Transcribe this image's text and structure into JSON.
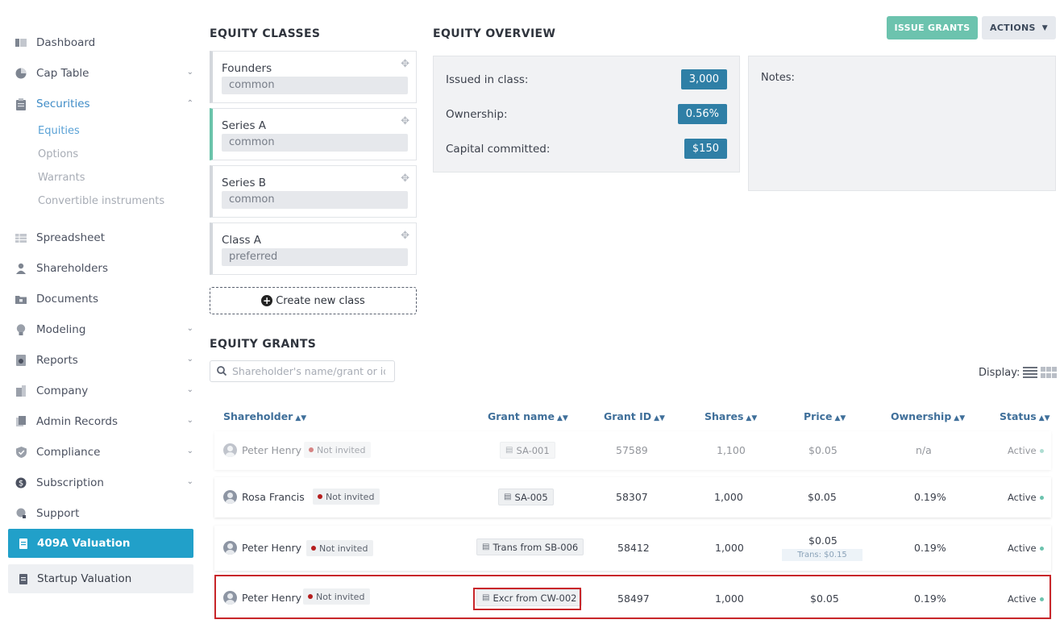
{
  "sidebar": {
    "items": [
      {
        "label": "Dashboard",
        "icon": "dashboard-icon",
        "chevron": ""
      },
      {
        "label": "Cap Table",
        "icon": "pie-chart-icon",
        "chevron": "down"
      },
      {
        "label": "Securities",
        "icon": "clipboard-icon",
        "chevron": "up",
        "active": true
      },
      {
        "label": "Spreadsheet",
        "icon": "spreadsheet-icon",
        "chevron": ""
      },
      {
        "label": "Shareholders",
        "icon": "person-icon",
        "chevron": ""
      },
      {
        "label": "Documents",
        "icon": "folder-lock-icon",
        "chevron": ""
      },
      {
        "label": "Modeling",
        "icon": "lightbulb-icon",
        "chevron": "down"
      },
      {
        "label": "Reports",
        "icon": "report-icon",
        "chevron": "down"
      },
      {
        "label": "Company",
        "icon": "building-icon",
        "chevron": "down"
      },
      {
        "label": "Admin Records",
        "icon": "admin-records-icon",
        "chevron": "down"
      },
      {
        "label": "Compliance",
        "icon": "shield-check-icon",
        "chevron": "down"
      },
      {
        "label": "Subscription",
        "icon": "dollar-circle-icon",
        "chevron": "down"
      },
      {
        "label": "Support",
        "icon": "support-icon",
        "chevron": ""
      }
    ],
    "securities_sub": [
      {
        "label": "Equities",
        "active": true
      },
      {
        "label": "Options"
      },
      {
        "label": "Warrants"
      },
      {
        "label": "Convertible instruments"
      }
    ],
    "valuation_409a": "409A Valuation",
    "startup_valuation": "Startup Valuation"
  },
  "equity_classes": {
    "title": "EQUITY CLASSES",
    "classes": [
      {
        "name": "Founders",
        "type": "common"
      },
      {
        "name": "Series A",
        "type": "common",
        "selected": true
      },
      {
        "name": "Series B",
        "type": "common"
      },
      {
        "name": "Class A",
        "type": "preferred"
      }
    ],
    "create_label": "Create new class"
  },
  "equity_overview": {
    "title": "EQUITY OVERVIEW",
    "issued_label": "Issued in class:",
    "issued_value": "3,000",
    "ownership_label": "Ownership:",
    "ownership_value": "0.56%",
    "capital_label": "Capital committed:",
    "capital_value": "$150",
    "notes_label": "Notes:"
  },
  "toolbar": {
    "issue_grants": "ISSUE GRANTS",
    "actions": "ACTIONS"
  },
  "equity_grants": {
    "title": "EQUITY GRANTS",
    "search_placeholder": "Shareholder's name/grant or id",
    "display_label": "Display:",
    "columns": [
      "Shareholder",
      "Grant name",
      "Grant ID",
      "Shares",
      "Price",
      "Ownership",
      "Status"
    ],
    "rows": [
      {
        "shareholder": "Peter Henry",
        "invite": "Not invited",
        "grant_name": "SA-001",
        "grant_id": "57589",
        "shares": "1,100",
        "price": "$0.05",
        "ownership": "n/a",
        "status": "Active"
      },
      {
        "shareholder": "Rosa Francis",
        "invite": "Not invited",
        "grant_name": "SA-005",
        "grant_id": "58307",
        "shares": "1,000",
        "price": "$0.05",
        "ownership": "0.19%",
        "status": "Active"
      },
      {
        "shareholder": "Peter Henry",
        "invite": "Not invited",
        "grant_name": "Trans from SB-006",
        "grant_id": "58412",
        "shares": "1,000",
        "price": "$0.05",
        "price_note": "Trans: $0.15",
        "ownership": "0.19%",
        "status": "Active"
      },
      {
        "shareholder": "Peter Henry",
        "invite": "Not invited",
        "grant_name": "Excr from CW-002",
        "grant_id": "58497",
        "shares": "1,000",
        "price": "$0.05",
        "ownership": "0.19%",
        "status": "Active"
      }
    ]
  },
  "colors": {
    "accent_blue": "#21a0c9",
    "teal": "#6cc3ae",
    "badge_blue": "#2f7fa6",
    "highlight_red": "#c8262a",
    "not_invited_dot": "#b51e1e"
  }
}
